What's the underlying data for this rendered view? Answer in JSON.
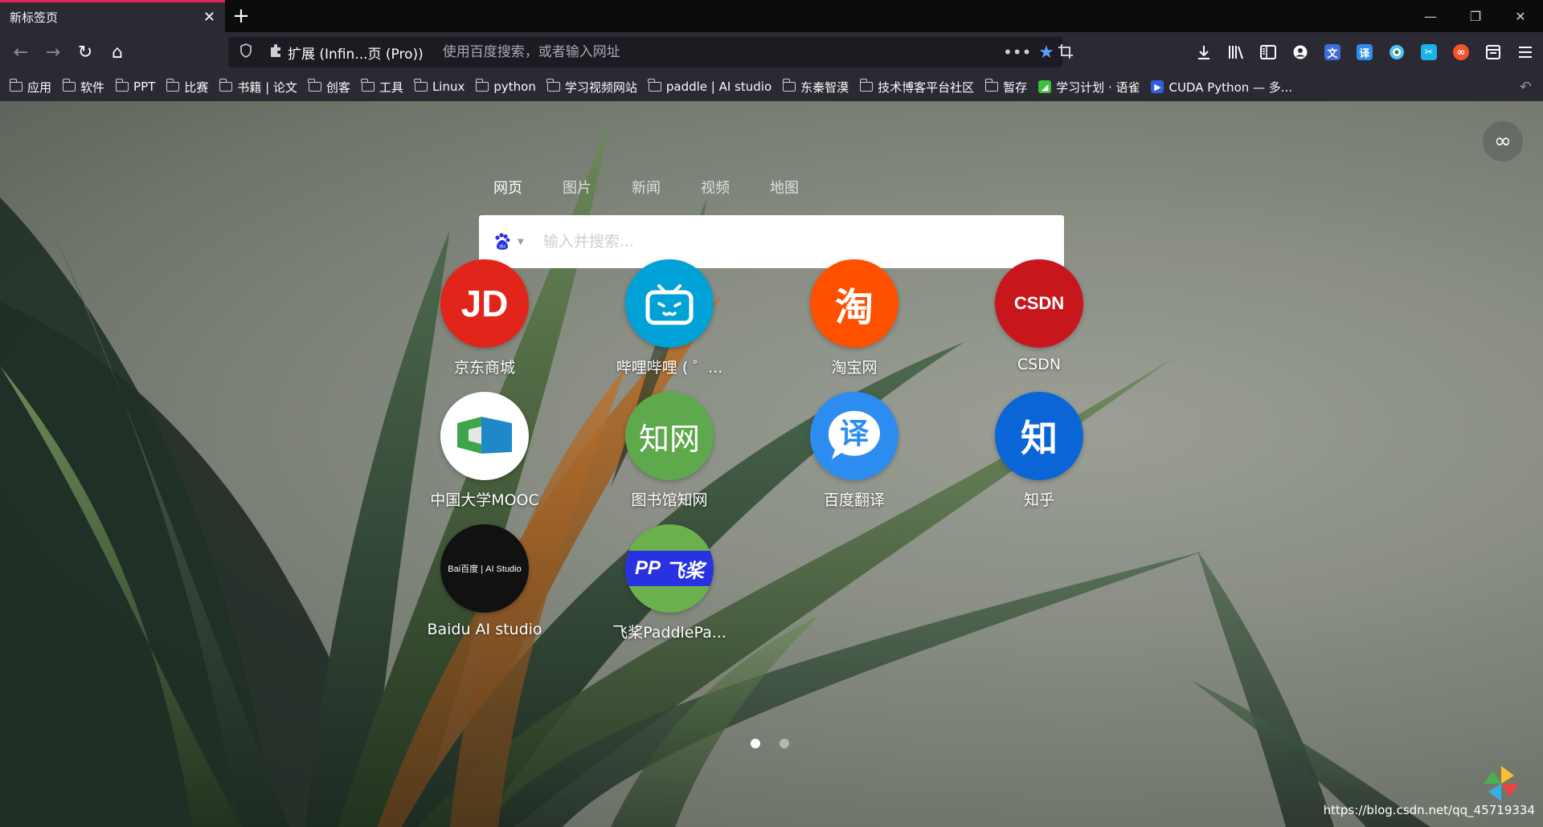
{
  "tab": {
    "title": "新标签页",
    "close_glyph": "✕"
  },
  "newtab": {
    "glyph": "+"
  },
  "window_controls": {
    "minimize": "—",
    "restore": "❐",
    "close": "✕"
  },
  "nav": {
    "back_glyph": "←",
    "forward_glyph": "→",
    "reload_glyph": "↻",
    "home_glyph": "⌂"
  },
  "urlbar": {
    "extension_label": "扩展 (Infin...页 (Pro))",
    "placeholder": "使用百度搜索，或者输入网址",
    "dots_glyph": "•••",
    "star_glyph": "★"
  },
  "toolbar": {
    "icons": [
      "download-icon",
      "library-icon",
      "sidebar-icon",
      "account-icon",
      "translate-icon",
      "yi-translate-icon",
      "circle-extension-icon",
      "screenshot-icon",
      "infinity-extension-icon",
      "container-icon",
      "menu-icon"
    ],
    "yi_label": "译"
  },
  "bookmarks": [
    {
      "label": "应用",
      "type": "folder"
    },
    {
      "label": "软件",
      "type": "folder"
    },
    {
      "label": "PPT",
      "type": "folder"
    },
    {
      "label": "比赛",
      "type": "folder"
    },
    {
      "label": "书籍 | 论文",
      "type": "folder"
    },
    {
      "label": "创客",
      "type": "folder"
    },
    {
      "label": "工具",
      "type": "folder"
    },
    {
      "label": "Linux",
      "type": "folder"
    },
    {
      "label": "python",
      "type": "folder"
    },
    {
      "label": "学习视频网站",
      "type": "folder"
    },
    {
      "label": "paddle | AI studio",
      "type": "folder"
    },
    {
      "label": "东秦智漠",
      "type": "folder"
    },
    {
      "label": "技术博客平台社区",
      "type": "folder"
    },
    {
      "label": "暂存",
      "type": "folder"
    },
    {
      "label": "学习计划 · 语雀",
      "type": "favicon",
      "color": "#3cc13b"
    },
    {
      "label": "CUDA Python — 多...",
      "type": "favicon",
      "color": "#2f5fe0"
    }
  ],
  "search": {
    "tabs": [
      "网页",
      "图片",
      "新闻",
      "视频",
      "地图"
    ],
    "active_tab": "网页",
    "placeholder": "输入并搜索...",
    "engine_icon": "baidu-paw-icon"
  },
  "tiles": [
    {
      "label": "京东商城",
      "logo": "JD",
      "bg": "#e1251b"
    },
    {
      "label": "哔哩哔哩 ( ゜...",
      "logo": "bilibili",
      "bg": "#00a1d6"
    },
    {
      "label": "淘宝网",
      "logo": "淘",
      "bg": "#ff5000"
    },
    {
      "label": "CSDN",
      "logo": "CSDN",
      "bg": "#c8161d"
    },
    {
      "label": "中国大学MOOC",
      "logo": "mooc",
      "bg": "#ffffff"
    },
    {
      "label": "图书馆知网",
      "logo": "知网",
      "bg": "#5ea94b"
    },
    {
      "label": "百度翻译",
      "logo": "译",
      "bg": "#2d8cf0"
    },
    {
      "label": "知乎",
      "logo": "知",
      "bg": "#0a66d6"
    },
    {
      "label": "Baidu AI studio",
      "logo": "Bai百度 | AI Studio",
      "bg": "#111111"
    },
    {
      "label": "飞桨PaddlePa...",
      "logo": "飞桨",
      "bg": "#2932e1"
    }
  ],
  "pager": {
    "pages": 2,
    "current": 1
  },
  "watermark": "https://blog.csdn.net/qq_45719334",
  "scroll_top_glyph": "∞"
}
